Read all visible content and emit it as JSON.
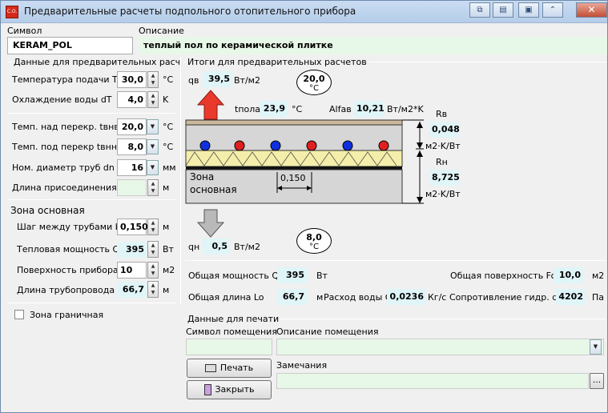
{
  "window": {
    "title": "Предварительные расчеты подпольного отопительного прибора",
    "icon_text": "C.O."
  },
  "header": {
    "symbol_label": "Символ",
    "symbol_value": "KERAM_POL",
    "description_label": "Описание",
    "description_value": "теплый пол по керамической плитке"
  },
  "left": {
    "group_title": "Данные для предварительных расчетов",
    "rows": [
      {
        "label": "Температура подачи  Tn",
        "value": "30,0",
        "unit": "°C"
      },
      {
        "label": "Охлаждение воды dT",
        "value": "4,0",
        "unit": "K"
      },
      {
        "label": "Темп. над перекр. tвнв",
        "value": "20,0",
        "unit": "°C"
      },
      {
        "label": "Темп. под перекр tвнн",
        "value": "8,0",
        "unit": "°C"
      },
      {
        "label": "Ном. диаметр труб dn",
        "value": "16",
        "unit": "мм"
      },
      {
        "label": "Длина присоединения Ln",
        "value": "",
        "unit": "м"
      }
    ],
    "zone_title": "Зона основная",
    "zone_rows": [
      {
        "label": "Шаг между трубами b",
        "value": "0,150",
        "unit": "м"
      },
      {
        "label": "Тепловая мощность Qo",
        "value": "395",
        "unit": "Вт"
      },
      {
        "label": "Поверхность прибора F",
        "value": "10",
        "unit": "м2"
      },
      {
        "label": "Длина трубопровода L",
        "value": "66,7",
        "unit": "м"
      }
    ],
    "border_zone_label": "Зона граничная"
  },
  "results": {
    "group_title": "Итоги для предварительных расчетов",
    "qv_label": "qв",
    "qv_value": "39,5",
    "qv_unit": "Вт/м2",
    "t_up": "20,0",
    "t_up_unit": "°C",
    "tfloor_label": "tпола",
    "tfloor_value": "23,9",
    "tfloor_unit": "°C",
    "alfa_label": "Alfaв",
    "alfa_value": "10,21",
    "alfa_unit": "Вт/м2*K",
    "rv_label": "Rв",
    "rv_value": "0,048",
    "rv_unit": "м2·K/Вт",
    "rn_label": "Rн",
    "rn_value": "8,725",
    "rn_unit": "м2·K/Вт",
    "zone_line1": "Зона",
    "zone_line2": "основная",
    "pitch": "0,150",
    "qn_label": "qн",
    "qn_value": "0,5",
    "qn_unit": "Вт/м2",
    "t_down": "8,0",
    "t_down_unit": "°C",
    "total_power_label": "Общая мощность Qo",
    "total_power_value": "395",
    "total_power_unit": "Вт",
    "total_surface_label": "Общая поверхность Fo",
    "total_surface_value": "10,0",
    "total_surface_unit": "м2",
    "total_length_label": "Общая длина Lo",
    "total_length_value": "66,7",
    "total_length_unit": "м",
    "flow_label": "Расход воды G",
    "flow_value": "0,0236",
    "flow_unit": "Кг/с",
    "resistance_label": "Сопротивление гидр. dP",
    "resistance_value": "4202",
    "resistance_unit": "Па"
  },
  "print": {
    "group_title": "Данные для печати",
    "room_symbol_label": "Символ помещения",
    "room_desc_label": "Описание помещения",
    "notes_label": "Замечания",
    "print_button": "Печать",
    "close_button": "Закрыть",
    "ellipsis": "..."
  },
  "colors": {
    "readonly_bg": "#e0f5f8",
    "arrow_up": "#e8392b",
    "arrow_down": "#b9b9b9",
    "pipe_red": "#e02020",
    "pipe_blue": "#1030e0",
    "insulation": "#f5eeaa"
  }
}
